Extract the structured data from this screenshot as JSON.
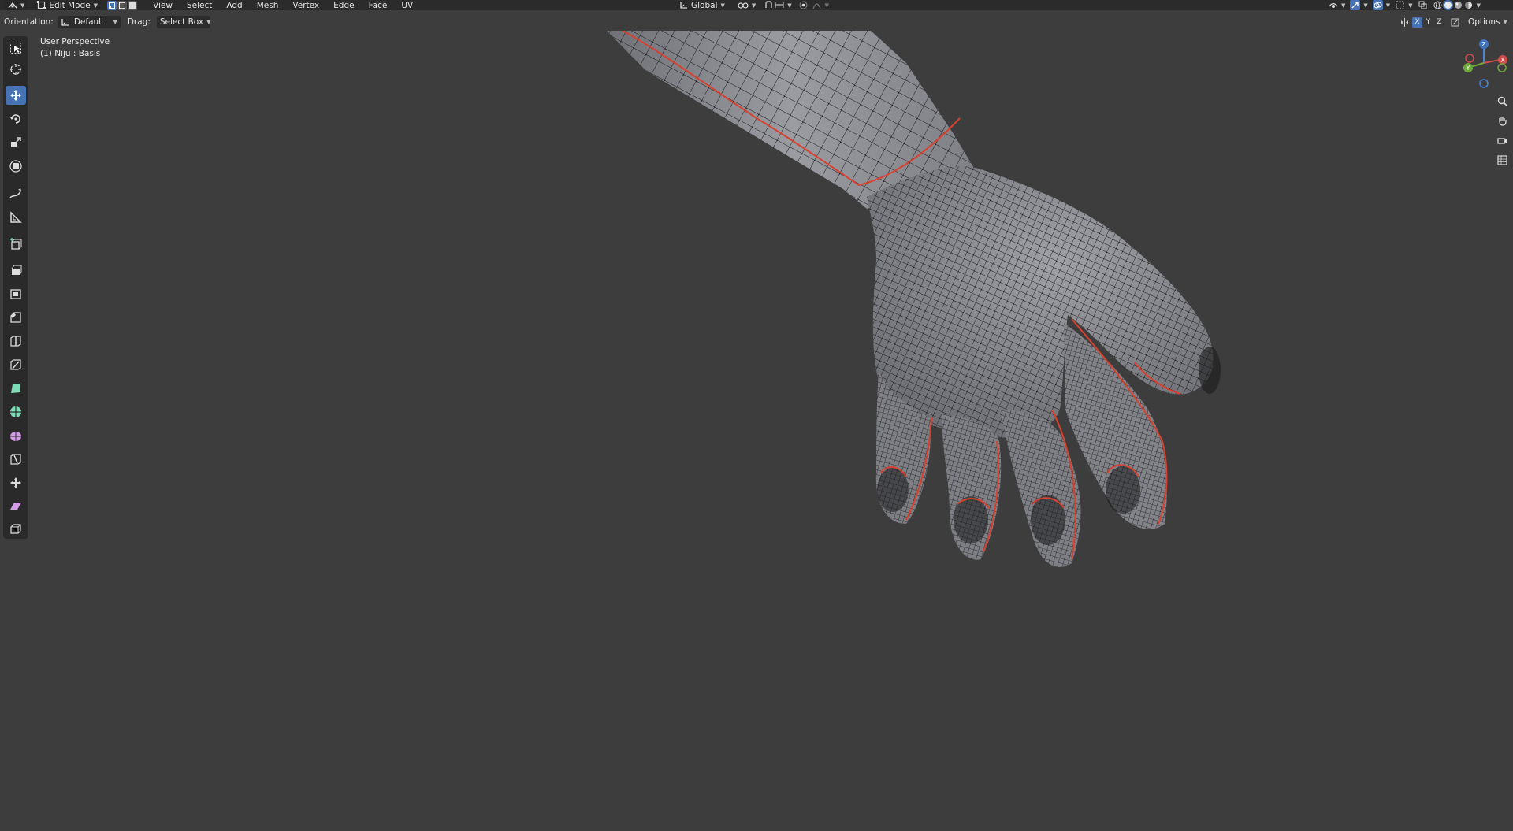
{
  "header": {
    "mode": "Edit Mode",
    "menus": [
      "View",
      "Select",
      "Add",
      "Mesh",
      "Vertex",
      "Edge",
      "Face",
      "UV"
    ],
    "transform_orientation": "Global"
  },
  "tool_settings": {
    "orientation_label": "Orientation:",
    "orientation_value": "Default",
    "drag_label": "Drag:",
    "drag_value": "Select Box",
    "axes": [
      "X",
      "Y",
      "Z"
    ],
    "options_label": "Options"
  },
  "viewport": {
    "perspective": "User Perspective",
    "object_info": "(1) Niju : Basis"
  },
  "gizmo": {
    "z": "Z",
    "y": "Y",
    "x": "X"
  },
  "toolbar": {
    "tools": [
      "select-box-icon",
      "cursor-icon",
      "move-icon",
      "rotate-icon",
      "scale-icon",
      "transform-icon",
      "annotate-icon",
      "measure-icon",
      "add-cube-icon",
      "extrude-icon",
      "inset-icon",
      "bevel-icon",
      "loop-cut-icon",
      "knife-icon",
      "poly-build-icon",
      "spin-icon",
      "smooth-icon",
      "edge-slide-icon",
      "shrink-fatten-icon",
      "shear-icon",
      "rip-icon"
    ],
    "active_tool": "move-icon"
  },
  "colors": {
    "viewport_bg": "#3d3d3d",
    "header_bg": "#2b2b2b",
    "accent": "#4772b3",
    "seam": "#d8402f",
    "mesh": "#8e9096"
  }
}
